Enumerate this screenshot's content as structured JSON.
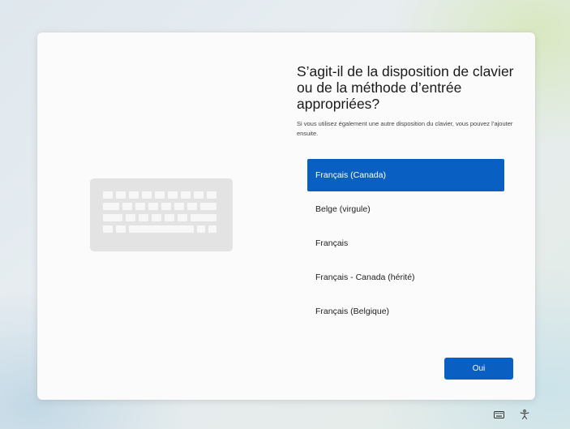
{
  "dialog": {
    "title": "S’agit-il de la disposition de clavier ou de la méthode d’entrée appropriées?",
    "subtitle": "Si vous utilisez également une autre disposition du clavier, vous pouvez l’ajouter ensuite.",
    "illustration": "keyboard-icon",
    "options": [
      {
        "label": "Français (Canada)",
        "selected": true
      },
      {
        "label": "Belge (virgule)",
        "selected": false
      },
      {
        "label": "Français",
        "selected": false
      },
      {
        "label": "Français - Canada (hérité)",
        "selected": false
      },
      {
        "label": "Français (Belgique)",
        "selected": false
      }
    ],
    "confirm_label": "Oui"
  },
  "taskbar": {
    "icons": [
      "keyboard-icon",
      "accessibility-icon"
    ]
  },
  "colors": {
    "accent": "#0a5fc2",
    "card": "#fbfbfb"
  }
}
